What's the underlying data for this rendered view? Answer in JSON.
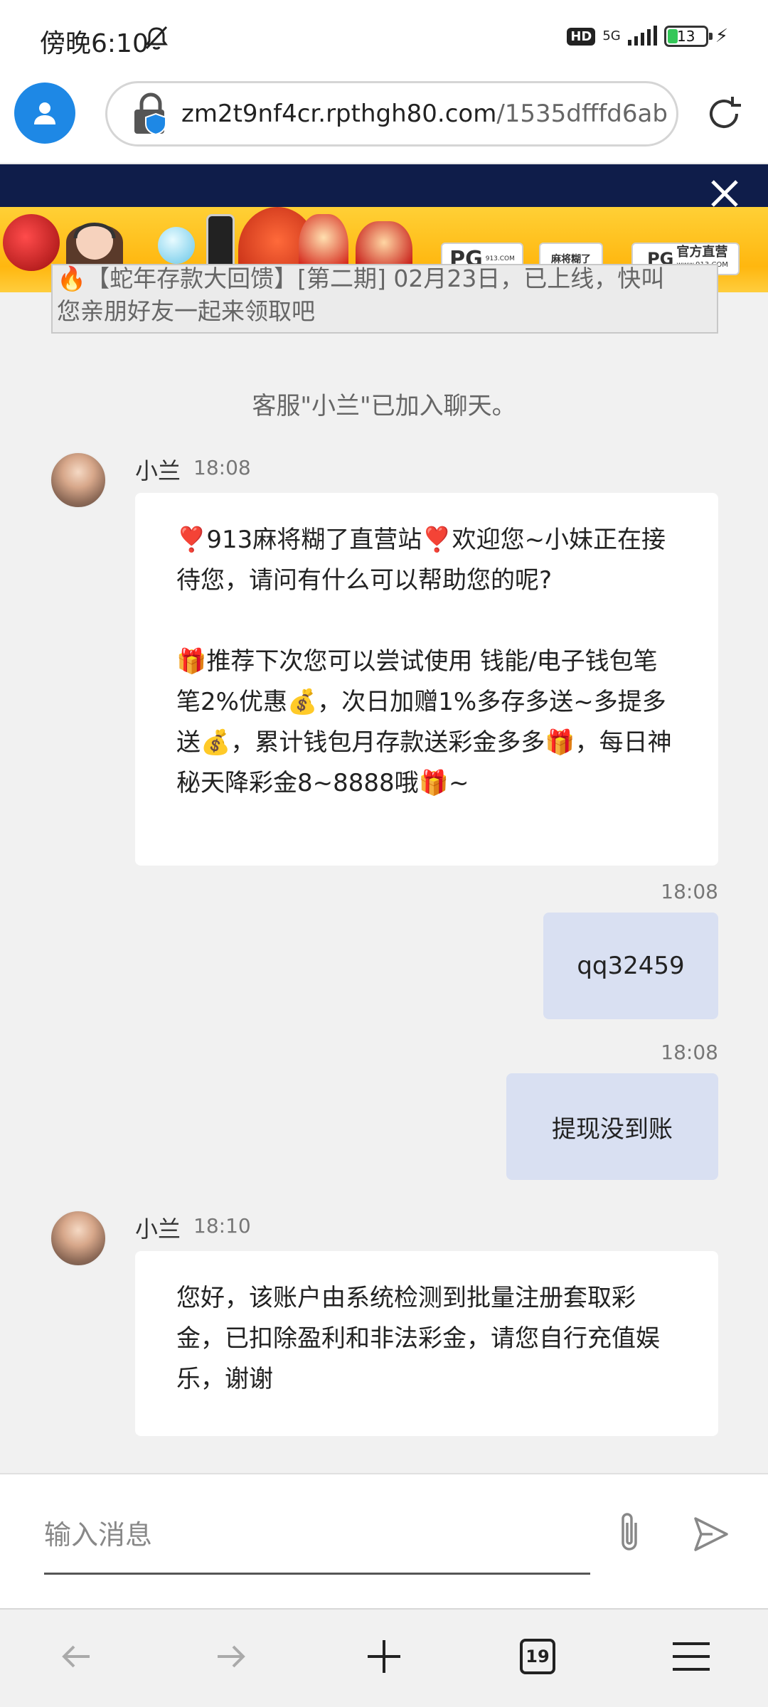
{
  "status_bar": {
    "time": "傍晚6:10",
    "hd": "HD",
    "network": "5G",
    "battery": "13"
  },
  "browser": {
    "url_host": "zm2t9nf4cr.rpthgh80.com",
    "url_path": "/1535dfffd6ab",
    "tab_count": "19"
  },
  "banner": {
    "chip_pg_text": "PG",
    "chip_pg_small": "913.COM",
    "chip_mahjong_text": "麻将糊了",
    "chip_pg2_big": "PG",
    "chip_pg2_text": "官方直营",
    "chip_pg2_url": "www.913.COM"
  },
  "notice": {
    "line1": "🔥【蛇年存款大回馈】[第二期] 02月23日，已上线，快叫",
    "line2": "您亲朋好友一起来领取吧"
  },
  "chat": {
    "system_message": "客服\"小兰\"已加入聊天。",
    "messages": [
      {
        "sender": "小兰",
        "time": "18:08",
        "text": "❣️913麻将糊了直营站❣️欢迎您~小妹正在接待您，请问有什么可以帮助您的呢?\n\n🎁推荐下次您可以尝试使用 钱能/电子钱包笔笔2%优惠💰，次日加赠1%多存多送~多提多送💰，累计钱包月存款送彩金多多🎁，每日神秘天降彩金8~8888哦🎁~"
      },
      {
        "time": "18:08",
        "text": "qq32459"
      },
      {
        "time": "18:08",
        "text": "提现没到账"
      },
      {
        "sender": "小兰",
        "time": "18:10",
        "text": "您好，该账户由系统检测到批量注册套取彩金，已扣除盈利和非法彩金，请您自行充值娱乐，谢谢"
      }
    ]
  },
  "input": {
    "placeholder": "输入消息"
  }
}
